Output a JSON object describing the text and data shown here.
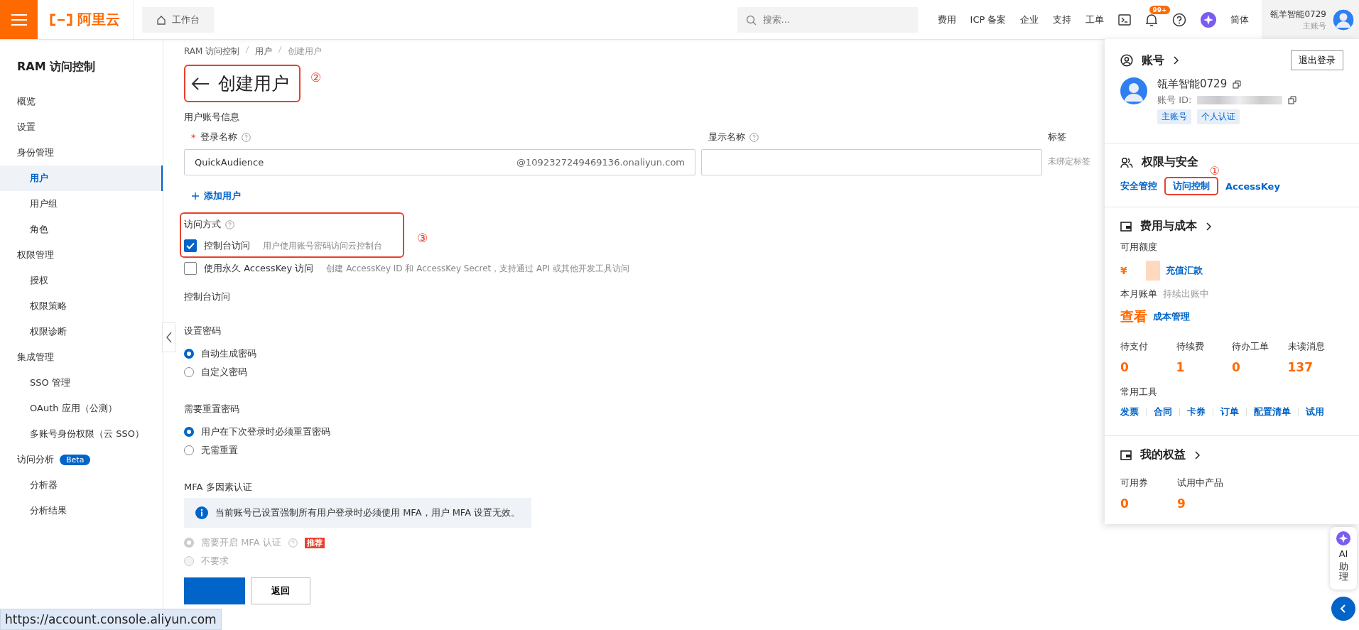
{
  "top_bar": {
    "logo": "阿里云",
    "workbench": "工作台",
    "search": {
      "placeholder": "搜索..."
    },
    "links": [
      "费用",
      "ICP 备案",
      "企业",
      "支持",
      "工单"
    ],
    "notification_badge": "99+",
    "language": "简体",
    "account_name": "瓴羊智能0729",
    "account_type": "主账号"
  },
  "sidebar": {
    "title": "RAM 访问控制",
    "items": [
      {
        "label": "概览",
        "selected": false
      },
      {
        "label": "设置",
        "selected": false
      },
      {
        "label": "身份管理",
        "selected": false,
        "children": [
          {
            "label": "用户",
            "selected": true
          },
          {
            "label": "用户组",
            "selected": false
          },
          {
            "label": "角色",
            "selected": false
          }
        ]
      },
      {
        "label": "权限管理",
        "selected": false,
        "children": [
          {
            "label": "授权",
            "selected": false
          },
          {
            "label": "权限策略",
            "selected": false
          },
          {
            "label": "权限诊断",
            "selected": false
          }
        ]
      },
      {
        "label": "集成管理",
        "selected": false,
        "children": [
          {
            "label": "SSO 管理",
            "selected": false
          },
          {
            "label": "OAuth 应用（公测）",
            "selected": false
          },
          {
            "label": "多账号身份权限（云 SSO）",
            "selected": false
          }
        ]
      },
      {
        "label": "访问分析",
        "badge": "Beta",
        "selected": false,
        "children": [
          {
            "label": "分析器",
            "selected": false
          },
          {
            "label": "分析结果",
            "selected": false
          }
        ]
      }
    ]
  },
  "breadcrumb": [
    "RAM 访问控制",
    "用户",
    "创建用户"
  ],
  "page_title": {
    "text": "创建用户",
    "annotation": "②"
  },
  "account_info": {
    "section": "用户账号信息",
    "login_name": {
      "label": "登录名称",
      "required_mark": "*",
      "value": "QuickAudience",
      "suffix": "@1092327249469136.onaliyun.com"
    },
    "display_name": {
      "label": "显示名称"
    },
    "tags": {
      "label": "标签",
      "value": "未绑定标签"
    },
    "add_user": "添加用户"
  },
  "access_method": {
    "label": "访问方式",
    "annotation": "③",
    "options": [
      {
        "label": "控制台访问",
        "hint": "用户使用账号密码访问云控制台",
        "checked": true
      },
      {
        "label": "使用永久 AccessKey 访问",
        "hint": "创建 AccessKey ID 和 AccessKey Secret，支持通过 API 或其他开发工具访问",
        "checked": false
      }
    ]
  },
  "console_access": "控制台访问",
  "password": {
    "label": "设置密码",
    "options": [
      {
        "label": "自动生成密码",
        "selected": true
      },
      {
        "label": "自定义密码",
        "selected": false
      }
    ]
  },
  "reset_password": {
    "label": "需要重置密码",
    "options": [
      {
        "label": "用户在下次登录时必须重置密码",
        "selected": true
      },
      {
        "label": "无需重置",
        "selected": false
      }
    ]
  },
  "mfa": {
    "label": "MFA 多因素认证",
    "notice": "当前账号已设置强制所有用户登录时必须使用 MFA，用户 MFA 设置无效。",
    "disabled": true,
    "options": [
      {
        "label": "需要开启 MFA 认证",
        "tag": "推荐",
        "selected": true
      },
      {
        "label": "不要求",
        "selected": false
      }
    ]
  },
  "buttons": {
    "back": "返回"
  },
  "status_url": "https://account.console.aliyun.com",
  "account_panel": {
    "title": "账号",
    "logout": "退出登录",
    "name": "瓴羊智能0729",
    "id_label": "账号 ID:",
    "tags": [
      "主账号",
      "个人认证"
    ],
    "security": {
      "title": "权限与安全",
      "annotation": "①",
      "links": [
        {
          "label": "安全管控",
          "highlighted": false
        },
        {
          "label": "访问控制",
          "highlighted": true
        },
        {
          "label": "AccessKey",
          "highlighted": false
        }
      ]
    },
    "cost": {
      "title": "费用与成本",
      "balance_label": "可用额度",
      "currency": "¥",
      "recharge": "充值汇款",
      "bill_label": "本月账单",
      "bill_status": "持续出账中",
      "view": "查看",
      "cost_management": "成本管理",
      "stats": [
        {
          "label": "待支付",
          "value": "0"
        },
        {
          "label": "待续费",
          "value": "1"
        },
        {
          "label": "待办工单",
          "value": "0"
        },
        {
          "label": "未读消息",
          "value": "137"
        }
      ],
      "tools_label": "常用工具",
      "tools": [
        "发票",
        "合同",
        "卡券",
        "订单",
        "配置清单",
        "试用"
      ]
    },
    "benefits": {
      "title": "我的权益",
      "stats": [
        {
          "label": "可用券",
          "value": "0"
        },
        {
          "label": "试用中产品",
          "value": "9"
        }
      ]
    }
  },
  "ai_assistant": [
    "AI",
    "助理"
  ]
}
